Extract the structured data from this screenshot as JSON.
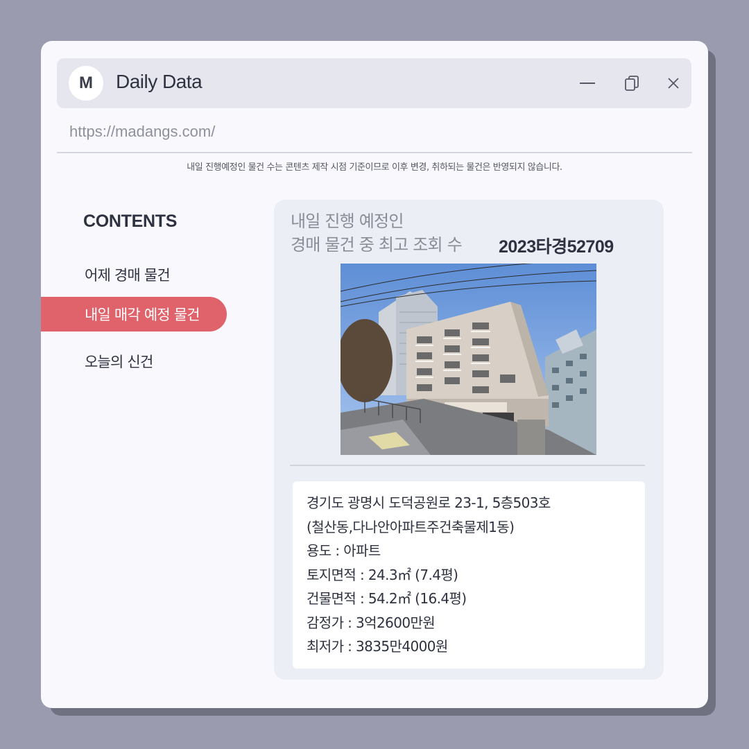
{
  "window": {
    "logo_letter": "M",
    "title": "Daily Data",
    "controls": [
      "minimize-icon",
      "copy-icon",
      "close-icon"
    ]
  },
  "address_bar": {
    "url": "https://madangs.com/"
  },
  "notice": "내일 진행예정인 물건 수는 콘텐츠 제작 시점 기준이므로 이후 변경, 취하되는 물건은 반영되지 않습니다.",
  "sidebar": {
    "title": "CONTENTS",
    "items": [
      {
        "label": "어제 경매 물건",
        "active": false
      },
      {
        "label": "내일 매각 예정 물건",
        "active": true
      },
      {
        "label": "오늘의 신건",
        "active": false
      }
    ]
  },
  "card": {
    "heading_line1": "내일 진행 예정인",
    "heading_line2": "경매 물건 중 최고 조회 수",
    "case_number": "2023타경52709",
    "details": [
      "경기도 광명시 도덕공원로 23-1, 5층503호",
      "(철산동,다나안아파트주건축물제1동)",
      "용도 : 아파트",
      "토지면적 : 24.3㎡ (7.4평)",
      "건물면적 : 54.2㎡ (16.4평)",
      "감정가 : 3억2600만원",
      "최저가 : 3835만4000원"
    ]
  },
  "colors": {
    "background": "#9a9bae",
    "window": "#f8f8fd",
    "accent": "#e0626a",
    "card": "#eceef6",
    "text_dark": "#2e3140",
    "text_muted": "#8a8c97"
  }
}
